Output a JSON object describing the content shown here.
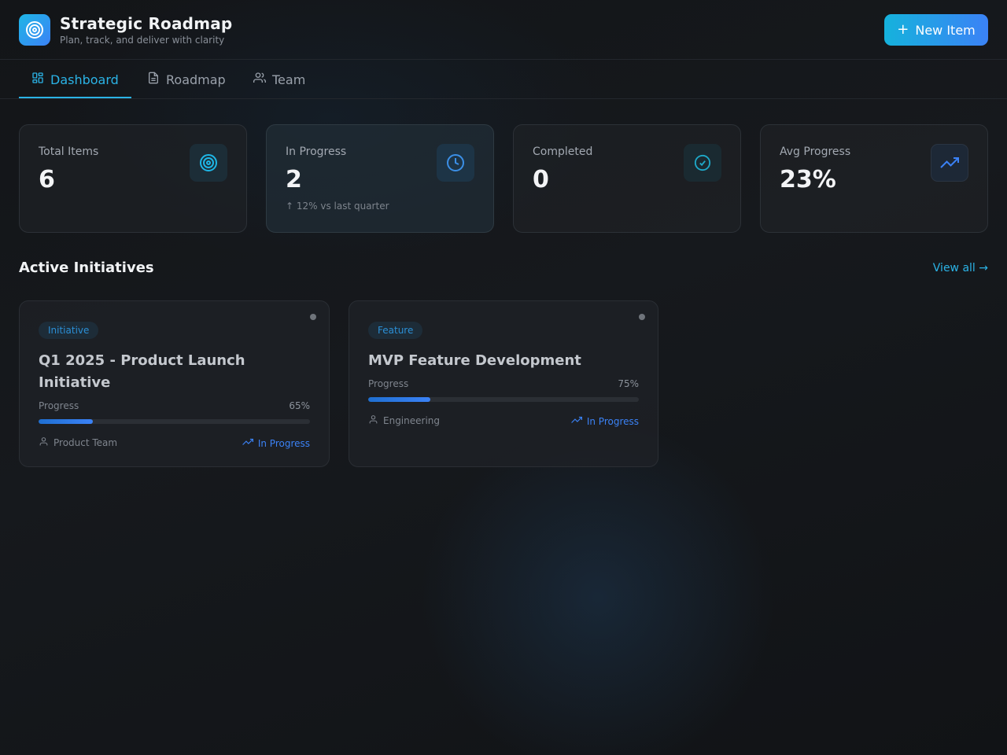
{
  "app": {
    "title": "Strategic Roadmap",
    "subtitle": "Plan, track, and deliver with clarity",
    "new_item_label": "New Item",
    "accent": "#2bb3e6",
    "brand_gradient": [
      "#1eb6e6",
      "#3b82f6"
    ]
  },
  "tabs": [
    {
      "label": "Dashboard",
      "icon": "dashboard-icon",
      "active": true
    },
    {
      "label": "Roadmap",
      "icon": "document-icon",
      "active": false
    },
    {
      "label": "Team",
      "icon": "users-icon",
      "active": false
    }
  ],
  "stats": [
    {
      "label": "Total Items",
      "value": "6",
      "icon": "target-icon"
    },
    {
      "label": "In Progress",
      "value": "2",
      "trend": "↑ 12% vs last quarter",
      "icon": "clock-icon"
    },
    {
      "label": "Completed",
      "value": "0",
      "icon": "check-circle-icon"
    },
    {
      "label": "Avg Progress",
      "value": "23%",
      "icon": "trending-up-icon"
    }
  ],
  "section": {
    "title": "Active Initiatives",
    "view_all": "View all →"
  },
  "initiatives": [
    {
      "tag": "Initiative",
      "title": "Q1 2025 - Product Launch Initiative",
      "progress_label": "Progress",
      "progress_pct": "65%",
      "progress_fill": 0.2,
      "owner": "Product Team",
      "status": "In Progress"
    },
    {
      "tag": "Feature",
      "title": "MVP Feature Development",
      "progress_label": "Progress",
      "progress_pct": "75%",
      "progress_fill": 0.23,
      "owner": "Engineering",
      "status": "In Progress"
    }
  ]
}
